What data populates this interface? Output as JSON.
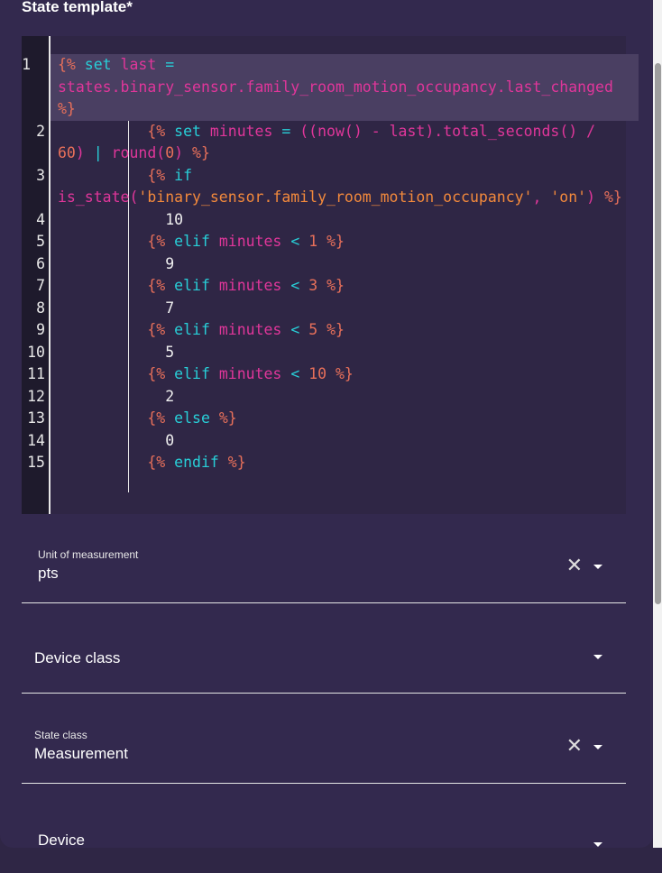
{
  "title": "State template*",
  "code": [
    {
      "n": "1",
      "active": true,
      "tokens": [
        [
          "{%",
          "brace"
        ],
        [
          " set ",
          "kw"
        ],
        [
          "last ",
          "id"
        ],
        [
          "= ",
          "op"
        ],
        [
          "states.binary_sensor.family_room_motion_occupancy.last_changed",
          "id"
        ],
        [
          " %}",
          "brace"
        ]
      ]
    },
    {
      "n": "2",
      "tokens": [
        [
          "          {%",
          "brace"
        ],
        [
          " set ",
          "kw"
        ],
        [
          "minutes ",
          "id"
        ],
        [
          "= ",
          "op"
        ],
        [
          "((now() - last).total_seconds() / ",
          "id"
        ],
        [
          "60",
          "lit"
        ],
        [
          ") ",
          "id"
        ],
        [
          "| ",
          "op"
        ],
        [
          "round(",
          "id"
        ],
        [
          "0",
          "lit"
        ],
        [
          ") ",
          "id"
        ],
        [
          "%}",
          "brace"
        ]
      ]
    },
    {
      "n": "3",
      "tokens": [
        [
          "          {%",
          "brace"
        ],
        [
          " if ",
          "kw"
        ],
        [
          "is_state(",
          "id"
        ],
        [
          "'binary_sensor.family_room_motion_occupancy'",
          "str"
        ],
        [
          ", ",
          "id"
        ],
        [
          "'on'",
          "str"
        ],
        [
          ") ",
          "id"
        ],
        [
          "%}",
          "brace"
        ]
      ]
    },
    {
      "n": "4",
      "tokens": [
        [
          "            10",
          "num"
        ]
      ]
    },
    {
      "n": "5",
      "tokens": [
        [
          "          {%",
          "brace"
        ],
        [
          " elif ",
          "kw"
        ],
        [
          "minutes ",
          "id"
        ],
        [
          "< ",
          "op"
        ],
        [
          "1 ",
          "lit"
        ],
        [
          "%}",
          "brace"
        ]
      ]
    },
    {
      "n": "6",
      "tokens": [
        [
          "            9",
          "num"
        ]
      ]
    },
    {
      "n": "7",
      "tokens": [
        [
          "          {%",
          "brace"
        ],
        [
          " elif ",
          "kw"
        ],
        [
          "minutes ",
          "id"
        ],
        [
          "< ",
          "op"
        ],
        [
          "3 ",
          "lit"
        ],
        [
          "%}",
          "brace"
        ]
      ]
    },
    {
      "n": "8",
      "tokens": [
        [
          "            7",
          "num"
        ]
      ]
    },
    {
      "n": "9",
      "tokens": [
        [
          "          {%",
          "brace"
        ],
        [
          " elif ",
          "kw"
        ],
        [
          "minutes ",
          "id"
        ],
        [
          "< ",
          "op"
        ],
        [
          "5 ",
          "lit"
        ],
        [
          "%}",
          "brace"
        ]
      ]
    },
    {
      "n": "10",
      "tokens": [
        [
          "            5",
          "num"
        ]
      ]
    },
    {
      "n": "11",
      "tokens": [
        [
          "          {%",
          "brace"
        ],
        [
          " elif ",
          "kw"
        ],
        [
          "minutes ",
          "id"
        ],
        [
          "< ",
          "op"
        ],
        [
          "10 ",
          "lit"
        ],
        [
          "%}",
          "brace"
        ]
      ]
    },
    {
      "n": "12",
      "tokens": [
        [
          "            2",
          "num"
        ]
      ]
    },
    {
      "n": "13",
      "tokens": [
        [
          "          {%",
          "brace"
        ],
        [
          " else ",
          "kw"
        ],
        [
          "%}",
          "brace"
        ]
      ]
    },
    {
      "n": "14",
      "tokens": [
        [
          "            0",
          "num"
        ]
      ]
    },
    {
      "n": "15",
      "tokens": [
        [
          "          {%",
          "brace"
        ],
        [
          " endif ",
          "kw"
        ],
        [
          "%}",
          "brace"
        ]
      ]
    }
  ],
  "fields": {
    "unit": {
      "label": "Unit of measurement",
      "value": "pts"
    },
    "device_class": {
      "label": "Device class"
    },
    "state_class": {
      "label": "State class",
      "value": "Measurement"
    },
    "device": {
      "label": "Device"
    }
  },
  "icons": {
    "clear": "✕"
  }
}
